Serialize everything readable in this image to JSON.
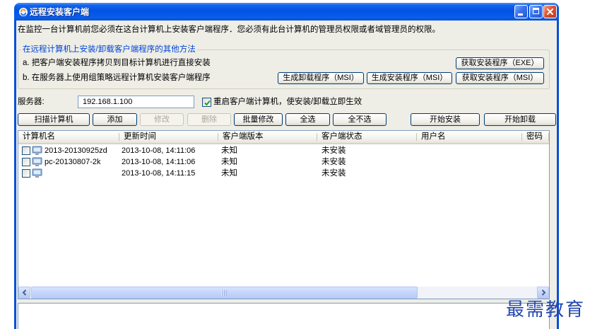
{
  "window": {
    "title": "远程安装客户端",
    "icon": "remote-install-icon",
    "controls": [
      "minimize-icon",
      "maximize-icon",
      "close-icon"
    ]
  },
  "intro_text": "在监控一台计算机前您必须在这台计算机上安装客户端程序．您必须有此台计算机的管理员权限或者域管理员的权限。",
  "other_methods": {
    "legend": "在远程计算机上安装/卸载客户端程序的其他方法",
    "method_a": "a. 把客户端安装程序拷贝到目标计算机进行直接安装",
    "method_b": "b. 在服务器上使用组策略远程计算机安装客户端程序",
    "get_exe_button": "获取安装程序（EXE）",
    "gen_uninstall_msi_button": "生成卸载程序（MSI）",
    "gen_install_msi_button": "生成安装程序（MSI）",
    "get_msi_button": "获取安装程序（MSI）"
  },
  "server": {
    "label": "服务器:",
    "address": "192.168.1.100",
    "restart_label": "重启客户端计算机，使安装/卸载立即生效",
    "restart_checked": true
  },
  "toolbar": {
    "buttons": [
      {
        "label": "扫描计算机",
        "enabled": true
      },
      {
        "label": "添加",
        "enabled": true
      },
      {
        "label": "修改",
        "enabled": false
      },
      {
        "label": "删除",
        "enabled": false
      },
      {
        "label": "批量修改",
        "enabled": true
      },
      {
        "label": "全选",
        "enabled": true
      },
      {
        "label": "全不选",
        "enabled": true
      },
      {
        "label": "开始安装",
        "enabled": true
      },
      {
        "label": "开始卸载",
        "enabled": true
      }
    ]
  },
  "computer_list": {
    "columns": [
      "计算机名",
      "更新时间",
      "客户端版本",
      "客户端状态",
      "用户名",
      "密码"
    ],
    "rows": [
      {
        "checked": false,
        "icon": "computer-icon",
        "name": "2013-20130925zd",
        "updated": "2013-10-08, 14:11:06",
        "version": "未知",
        "status": "未安装"
      },
      {
        "checked": false,
        "icon": "computer-icon",
        "name": "pc-20130807-2k",
        "updated": "2013-10-08, 14:11:06",
        "version": "未知",
        "status": "未安装"
      },
      {
        "checked": false,
        "icon": "computer-icon",
        "name": "",
        "updated": "2013-10-08, 14:11:15",
        "version": "未知",
        "status": "未安装"
      }
    ]
  },
  "watermark": "最需教育",
  "colors": {
    "title_bar": "#0054E3",
    "close_button": "#DC5430",
    "groupbox_title": "#0046D5",
    "disabled_text": "#ACA899",
    "checkmark": "#21A121",
    "watermark": "#2347AD"
  }
}
